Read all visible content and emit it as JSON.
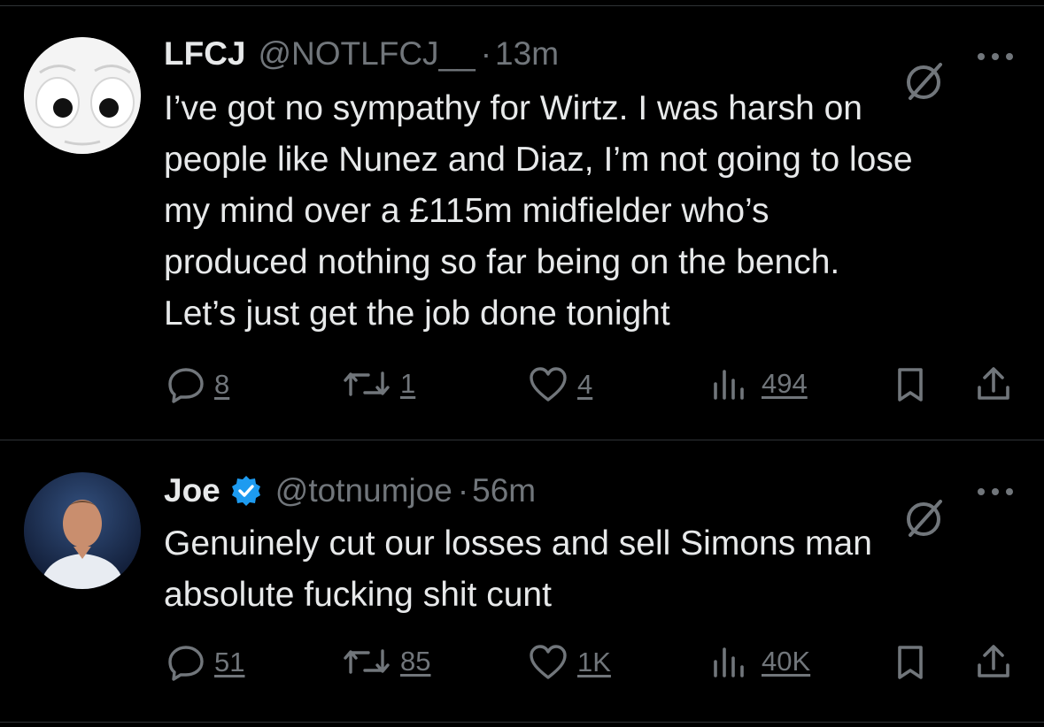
{
  "tweets": [
    {
      "name": "LFCJ",
      "handle": "@NOTLFCJ__",
      "dot": "·",
      "time": "13m",
      "verified": false,
      "lines": [
        "I’ve got no sympathy for Wirtz. I was harsh on",
        "people like Nunez and Diaz, I’m not going to lose",
        "my mind over a £115m midfielder who’s",
        "produced nothing so far being on the bench.",
        "Let’s just get the job done tonight"
      ],
      "replies": "8",
      "reposts": "1",
      "likes": "4",
      "views": "494"
    },
    {
      "name": "Joe",
      "handle": "@totnumjoe",
      "dot": "·",
      "time": "56m",
      "verified": true,
      "lines": [
        "Genuinely cut our losses and sell Simons man",
        "absolute fucking shit cunt"
      ],
      "replies": "51",
      "reposts": "85",
      "likes": "1K",
      "views": "40K"
    }
  ],
  "colors": {
    "background": "#000000",
    "text": "#e7e9ea",
    "muted": "#71767b",
    "verified": "#1d9bf0",
    "divider": "#2f3336"
  },
  "icons": [
    "grok-icon",
    "more-icon",
    "reply-icon",
    "repost-icon",
    "like-icon",
    "views-icon",
    "bookmark-icon",
    "share-icon",
    "verified-badge-icon"
  ]
}
